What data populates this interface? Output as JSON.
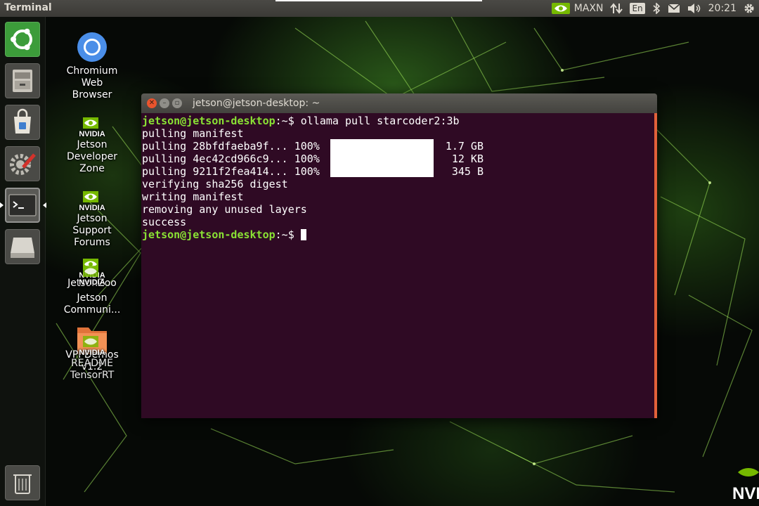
{
  "top_panel": {
    "title": "Terminal",
    "power_mode": "MAXN",
    "lang": "En",
    "time": "20:21",
    "icons": [
      "nvidia-icon",
      "network-icon",
      "bluetooth-icon",
      "mail-icon",
      "volume-icon",
      "settings-gear-icon"
    ]
  },
  "launcher": {
    "items": [
      {
        "name": "ubuntu-dash",
        "icon": "ubuntu-icon"
      },
      {
        "name": "files",
        "icon": "file-cabinet-icon"
      },
      {
        "name": "software",
        "icon": "shopping-bag-icon"
      },
      {
        "name": "system-settings",
        "icon": "settings-wrench-icon"
      },
      {
        "name": "terminal",
        "icon": "terminal-icon",
        "active": true
      },
      {
        "name": "disk",
        "icon": "drive-icon"
      },
      {
        "name": "trash",
        "icon": "trash-icon"
      }
    ]
  },
  "desktop_icons": [
    {
      "label_lines": [
        "Chromium",
        "Web",
        "Browser"
      ],
      "icon": "chromium-icon"
    },
    {
      "label_lines": [
        "Jetson",
        "Developer",
        "Zone"
      ],
      "icon": "nvidia-logo-icon",
      "logo_text": "NVIDIA"
    },
    {
      "label_lines": [
        "Jetson",
        "Support",
        "Forums"
      ],
      "icon": "nvidia-logo-icon",
      "logo_text": "NVIDIA"
    },
    {
      "label_lines": [
        "JetsonZoo"
      ],
      "icon": "nvidia-logo-icon",
      "logo_text": "NVIDIA"
    },
    {
      "label_lines": [
        "Jetson",
        "Communi..."
      ],
      "icon": "nvidia-logo-icon",
      "logo_text": "NVIDIA"
    },
    {
      "label_lines": [
        "VPI Demos",
        "v1.2"
      ],
      "icon": "folder-icon"
    },
    {
      "label_lines": [
        "README",
        "TensorRT"
      ],
      "icon": "nvidia-logo-icon",
      "logo_text": "NVIDIA"
    }
  ],
  "terminal": {
    "title": "jetson@jetson-desktop: ~",
    "prompt_user": "jetson@jetson-desktop",
    "prompt_path": ":~$ ",
    "command": "ollama pull starcoder2:3b",
    "output": [
      "pulling manifest",
      "pulling 28bfdfaeba9f... 100%",
      "pulling 4ec42cd966c9... 100%",
      "pulling 9211f2fea414... 100%",
      "verifying sha256 digest",
      "writing manifest",
      "removing any unused layers",
      "success"
    ],
    "sizes": [
      "1.7 GB",
      "12 KB",
      "345 B"
    ]
  },
  "wallpaper_brand": "NVID",
  "colors": {
    "terminal_bg": "#2f0a24",
    "prompt_green": "#8ae234",
    "accent_orange": "#e2613a"
  }
}
